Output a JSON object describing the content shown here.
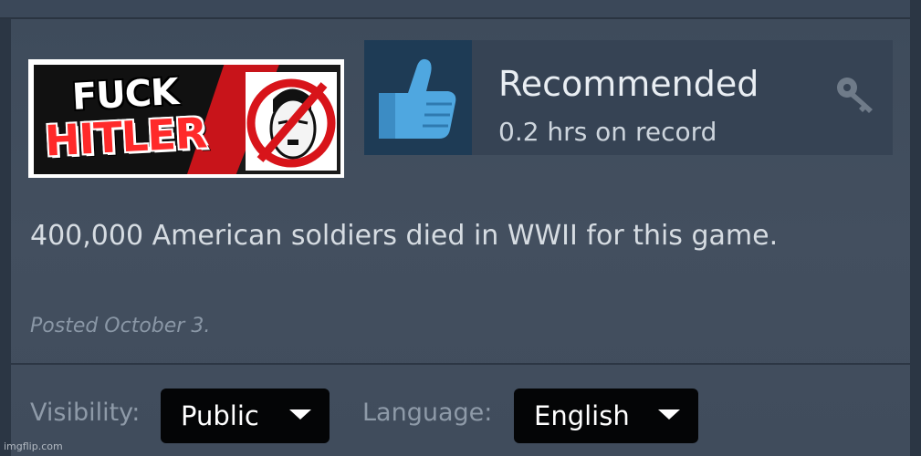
{
  "game_banner": {
    "line1": "FUCK",
    "line2": "HITLER"
  },
  "recommendation": {
    "verdict": "Recommended",
    "hours": "0.2 hrs on record",
    "icons": {
      "thumb": "thumbs-up-icon",
      "key": "key-icon"
    }
  },
  "review": {
    "text": "400,000 American soldiers died in WWII for this game.",
    "posted": "Posted October 3."
  },
  "footer": {
    "visibility_label": "Visibility:",
    "visibility_value": "Public",
    "language_label": "Language:",
    "language_value": "English"
  },
  "watermark": "imgflip.com",
  "colors": {
    "thumb_blue": "#4fa7e0",
    "tile_blue": "#1e3b55",
    "card_bg": "#414e5e",
    "select_bg": "#040506"
  }
}
